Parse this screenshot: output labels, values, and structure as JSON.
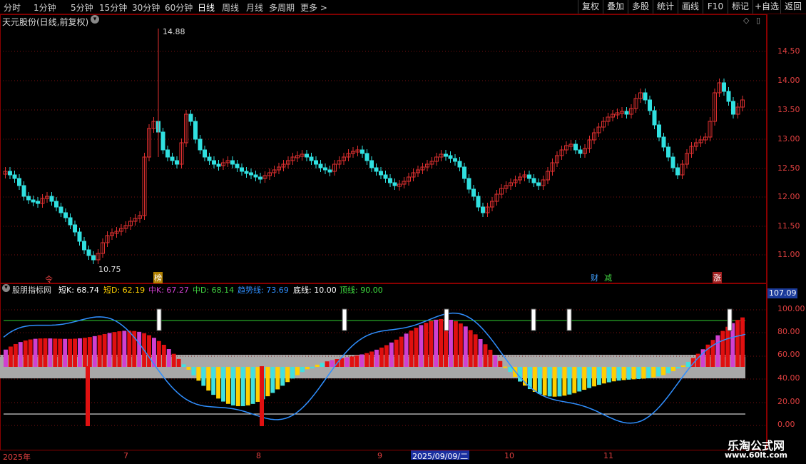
{
  "toolbar": {
    "timeframes": [
      "分时",
      "1分钟",
      "5分钟",
      "15分钟",
      "30分钟",
      "60分钟",
      "日线",
      "周线",
      "月线",
      "多周期",
      "更多 >"
    ],
    "active": "日线",
    "right_buttons": [
      "复权",
      "叠加",
      "多股",
      "统计",
      "画线",
      "F10",
      "标记",
      "+自选",
      "返回"
    ]
  },
  "main_panel": {
    "title": "天元股份(日线,前复权)",
    "high_label": "14.88",
    "low_label": "10.75",
    "y_ticks": [
      "14.50",
      "14.00",
      "13.50",
      "13.00",
      "12.50",
      "12.00",
      "11.50",
      "11.00"
    ],
    "markers": [
      "榜",
      "财",
      "减",
      "涨"
    ],
    "small_marker": "令"
  },
  "indicator_panel": {
    "name": "股朋指标网",
    "items": [
      {
        "label": "短K: 68.74",
        "color": "#ffffff"
      },
      {
        "label": "短D: 62.19",
        "color": "#ffd000"
      },
      {
        "label": "中K: 67.27",
        "color": "#d040d0"
      },
      {
        "label": "中D: 68.14",
        "color": "#40d040"
      },
      {
        "label": "趋势线: 73.69",
        "color": "#2f8fff"
      },
      {
        "label": "底线: 10.00",
        "color": "#ffffff"
      },
      {
        "label": "顶线: 90.00",
        "color": "#40e040"
      }
    ],
    "y_ticks": [
      "100.00",
      "80.00",
      "60.00",
      "40.00",
      "20.00",
      "0.00"
    ],
    "current_value": "107.09"
  },
  "x_axis": {
    "labels": [
      "2025年",
      "7",
      "8",
      "9",
      "10",
      "11"
    ],
    "cursor_date": "2025/09/09/二"
  },
  "watermark": {
    "title": "乐淘公式网",
    "url": "www.60lt.com"
  }
}
